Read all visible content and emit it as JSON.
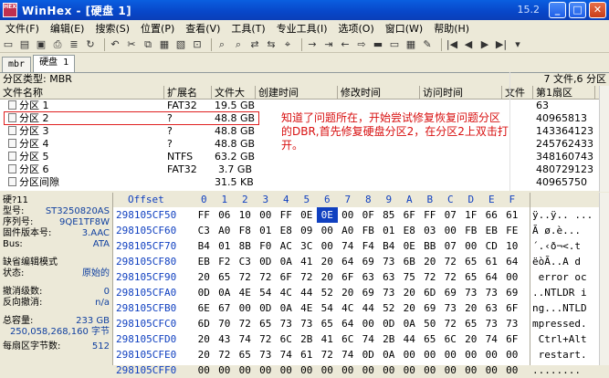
{
  "window": {
    "title": "WinHex - [硬盘 1]",
    "version": "15.2",
    "icon_text": "HEX"
  },
  "menu": [
    "文件(F)",
    "编辑(E)",
    "搜索(S)",
    "位置(P)",
    "查看(V)",
    "工具(T)",
    "专业工具(I)",
    "选项(O)",
    "窗口(W)",
    "帮助(H)"
  ],
  "tabs": [
    {
      "label": "mbr"
    },
    {
      "label": "硬盘 1"
    }
  ],
  "info": {
    "left": "分区类型: MBR",
    "right": "7 文件,6 分区"
  },
  "file_columns": [
    "文件名称",
    "扩展名",
    "文件大",
    "创建时间",
    "修改时间",
    "访问时间",
    "文件",
    "第1扇区"
  ],
  "files": [
    {
      "name": "分区 1",
      "ext": "FAT32",
      "size": "19.5 GB",
      "sector": "63"
    },
    {
      "name": "分区 2",
      "ext": "?",
      "size": "48.8 GB",
      "sector": "40965813"
    },
    {
      "name": "分区 3",
      "ext": "?",
      "size": "48.8 GB",
      "sector": "143364123"
    },
    {
      "name": "分区 4",
      "ext": "?",
      "size": "48.8 GB",
      "sector": "245762433"
    },
    {
      "name": "分区 5",
      "ext": "NTFS",
      "size": "63.2 GB",
      "sector": "348160743"
    },
    {
      "name": "分区 6",
      "ext": "FAT32",
      "size": "3.7 GB",
      "sector": "480729123"
    },
    {
      "name": "分区间隙",
      "ext": "",
      "size": "31.5 KB",
      "sector": "40965750"
    }
  ],
  "annotation": "知道了问题所在，开始尝试修复恢复问题分区的DBR,首先修复硬盘分区2，在分区2上双击打开。",
  "left_panel": {
    "disk": "硬?11",
    "model_label": "型号:",
    "model": "ST3250820AS",
    "serial_label": "序列号:",
    "serial": "9QE1TF8W",
    "firmware_label": "固件版本号:",
    "firmware": "3.AAC",
    "bus_label": "Bus:",
    "bus": "ATA",
    "mode_label": "缺省编辑模式",
    "state_label": "状态:",
    "state": "原始的",
    "undo_label": "撤消级数:",
    "undo": "0",
    "reverse_label": "反向撤消:",
    "reverse": "n/a",
    "capacity_label": "总容量:",
    "capacity": "233 GB",
    "capacity_bytes": "250,058,268,160 字节",
    "bps_label": "每扇区字节数:",
    "bps": "512"
  },
  "hex": {
    "offset_label": "Offset",
    "columns": [
      "0",
      "1",
      "2",
      "3",
      "4",
      "5",
      "6",
      "7",
      "8",
      "9",
      "A",
      "B",
      "C",
      "D",
      "E",
      "F"
    ],
    "rows": [
      {
        "addr": "298105CF50",
        "bytes": [
          "FF",
          "06",
          "10",
          "00",
          "FF",
          "0E",
          "0E",
          "00",
          "0F",
          "85",
          "6F",
          "FF",
          "07",
          "1F",
          "66",
          "61"
        ],
        "ascii": "ÿ..ÿ.. ..."
      },
      {
        "addr": "298105CF60",
        "bytes": [
          "C3",
          "A0",
          "F8",
          "01",
          "E8",
          "09",
          "00",
          "A0",
          "FB",
          "01",
          "E8",
          "03",
          "00",
          "FB",
          "EB",
          "FE"
        ],
        "ascii": "Ã ø.è..."
      },
      {
        "addr": "298105CF70",
        "bytes": [
          "B4",
          "01",
          "8B",
          "F0",
          "AC",
          "3C",
          "00",
          "74",
          "F4",
          "B4",
          "0E",
          "BB",
          "07",
          "00",
          "CD",
          "10"
        ],
        "ascii": "´.‹ð¬<.t"
      },
      {
        "addr": "298105CF80",
        "bytes": [
          "EB",
          "F2",
          "C3",
          "0D",
          "0A",
          "41",
          "20",
          "64",
          "69",
          "73",
          "6B",
          "20",
          "72",
          "65",
          "61",
          "64"
        ],
        "ascii": "ëòÃ..A d"
      },
      {
        "addr": "298105CF90",
        "bytes": [
          "20",
          "65",
          "72",
          "72",
          "6F",
          "72",
          "20",
          "6F",
          "63",
          "63",
          "75",
          "72",
          "72",
          "65",
          "64",
          "00"
        ],
        "ascii": " error oc"
      },
      {
        "addr": "298105CFA0",
        "bytes": [
          "0D",
          "0A",
          "4E",
          "54",
          "4C",
          "44",
          "52",
          "20",
          "69",
          "73",
          "20",
          "6D",
          "69",
          "73",
          "73",
          "69"
        ],
        "ascii": "..NTLDR i"
      },
      {
        "addr": "298105CFB0",
        "bytes": [
          "6E",
          "67",
          "00",
          "0D",
          "0A",
          "4E",
          "54",
          "4C",
          "44",
          "52",
          "20",
          "69",
          "73",
          "20",
          "63",
          "6F"
        ],
        "ascii": "ng...NTLD"
      },
      {
        "addr": "298105CFC0",
        "bytes": [
          "6D",
          "70",
          "72",
          "65",
          "73",
          "73",
          "65",
          "64",
          "00",
          "0D",
          "0A",
          "50",
          "72",
          "65",
          "73",
          "73"
        ],
        "ascii": "mpressed."
      },
      {
        "addr": "298105CFD0",
        "bytes": [
          "20",
          "43",
          "74",
          "72",
          "6C",
          "2B",
          "41",
          "6C",
          "74",
          "2B",
          "44",
          "65",
          "6C",
          "20",
          "74",
          "6F"
        ],
        "ascii": " Ctrl+Alt"
      },
      {
        "addr": "298105CFE0",
        "bytes": [
          "20",
          "72",
          "65",
          "73",
          "74",
          "61",
          "72",
          "74",
          "0D",
          "0A",
          "00",
          "00",
          "00",
          "00",
          "00",
          "00"
        ],
        "ascii": " restart."
      },
      {
        "addr": "298105CFF0",
        "bytes": [
          "00",
          "00",
          "00",
          "00",
          "00",
          "00",
          "00",
          "00",
          "00",
          "00",
          "00",
          "00",
          "00",
          "00",
          "00",
          "00"
        ],
        "ascii": "........"
      }
    ]
  }
}
